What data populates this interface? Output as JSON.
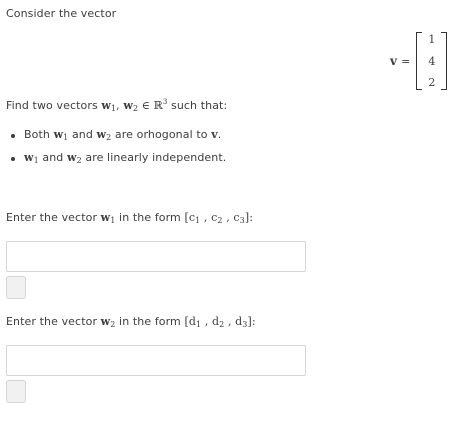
{
  "intro": "Consider the vector",
  "vector": {
    "lhs": "v",
    "eq": "=",
    "entries": [
      "1",
      "4",
      "2"
    ]
  },
  "task": {
    "prefix": "Find two vectors ",
    "w1": "w",
    "w1_sub": "1",
    "sep": ", ",
    "w2": "w",
    "w2_sub": "2",
    "in": " ∈ ",
    "R": "ℝ",
    "R_sup": "3",
    "suffix": " such that:"
  },
  "bullets": [
    {
      "prefix": "Both ",
      "a": "w",
      "a_sub": "1",
      "mid": " and ",
      "b": "w",
      "b_sub": "2",
      "suffix": " are orhogonal to ",
      "c": "v",
      "end": "."
    },
    {
      "a": "w",
      "a_sub": "1",
      "mid": " and ",
      "b": "w",
      "b_sub": "2",
      "suffix": " are linearly independent."
    }
  ],
  "field1": {
    "label_prefix": "Enter the vector ",
    "w": "w",
    "w_sub": "1",
    "label_mid": " in the form ",
    "form_open": "[c",
    "s1": "1",
    "c2": " , c",
    "s2": "2",
    "c3": " , c",
    "s3": "3",
    "form_close": "]:",
    "value": ""
  },
  "field2": {
    "label_prefix": "Enter the vector ",
    "w": "w",
    "w_sub": "2",
    "label_mid": " in the form ",
    "form_open": "[d",
    "s1": "1",
    "c2": " , d",
    "s2": "2",
    "c3": " , d",
    "s3": "3",
    "form_close": "]:",
    "value": ""
  }
}
